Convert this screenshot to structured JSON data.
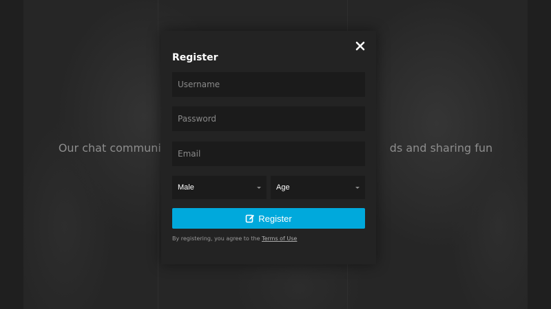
{
  "background": {
    "hero_text": "Our chat communi                                                                              ds and sharing fun"
  },
  "modal": {
    "title": "Register",
    "close_icon": "close-icon",
    "username_placeholder": "Username",
    "password_placeholder": "Password",
    "email_placeholder": "Email",
    "gender_selected": "Male",
    "age_selected": "Age",
    "register_label": "Register",
    "register_icon": "edit-icon",
    "terms_prefix": "By registering, you agree to the ",
    "terms_link": "Terms of Use"
  },
  "colors": {
    "accent": "#00a9dc",
    "modal_bg": "#232323",
    "field_bg": "#1b1b1b"
  }
}
